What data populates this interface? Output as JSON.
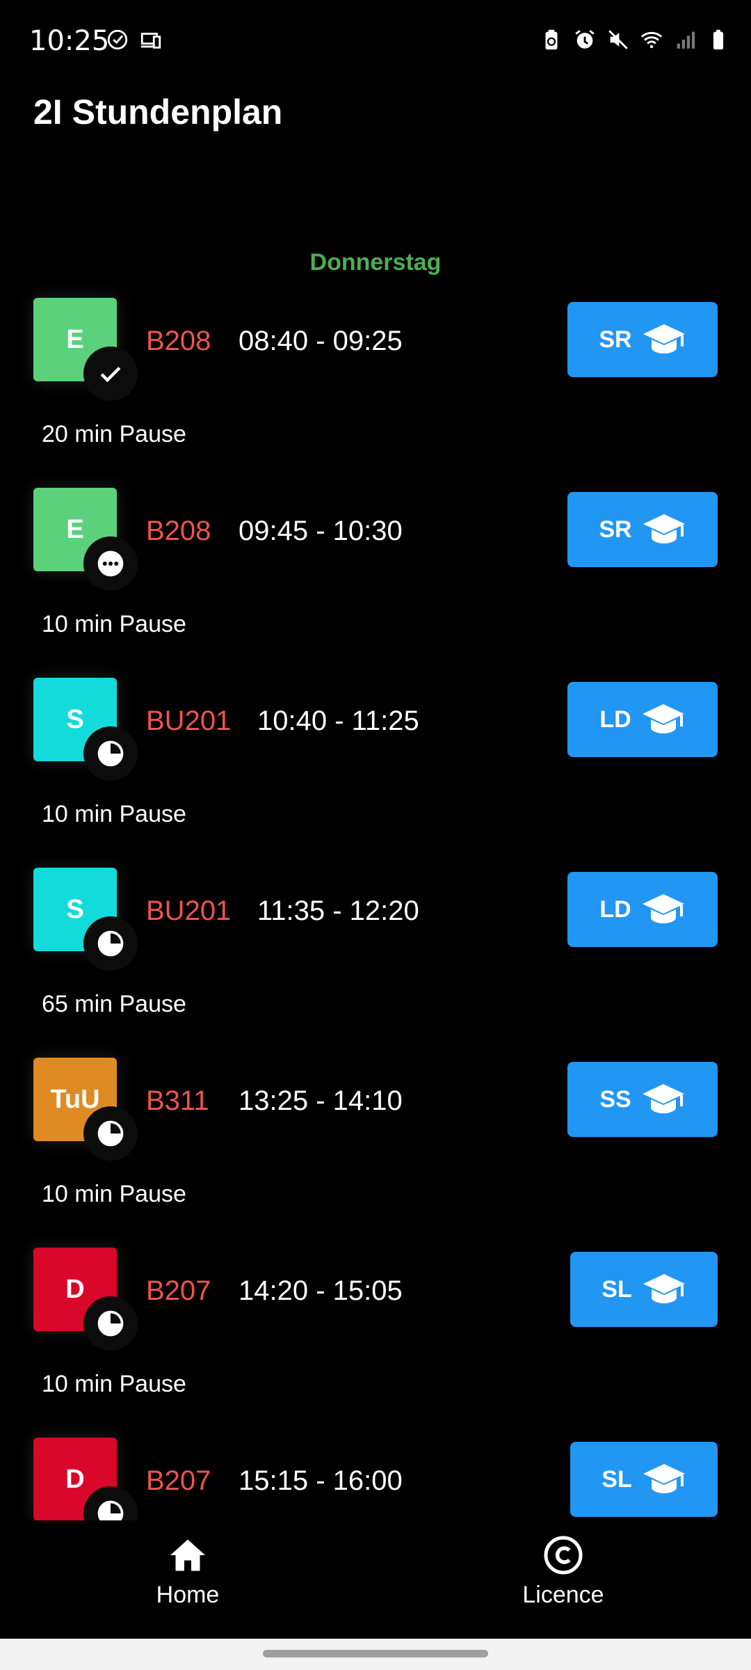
{
  "status_bar": {
    "time": "10:25",
    "left_icons": [
      "check-circle-icon",
      "devices-icon"
    ],
    "right_icons": [
      "battery-saver-icon",
      "alarm-icon",
      "mute-icon",
      "wifi-icon",
      "signal-icon",
      "battery-icon"
    ]
  },
  "app": {
    "title": "2I Stundenplan"
  },
  "day": "Donnerstag",
  "lessons": [
    {
      "subject": "E",
      "color": "#5bd17c",
      "status": "done",
      "room": "B208",
      "time": "08:40 - 09:25",
      "teacher": "SR"
    },
    {
      "subject": "E",
      "color": "#5bd17c",
      "status": "current",
      "room": "B208",
      "time": "09:45 - 10:30",
      "teacher": "SR"
    },
    {
      "subject": "S",
      "color": "#14dbdb",
      "status": "upcoming",
      "room": "BU201",
      "time": "10:40 - 11:25",
      "teacher": "LD"
    },
    {
      "subject": "S",
      "color": "#14dbdb",
      "status": "upcoming",
      "room": "BU201",
      "time": "11:35 - 12:20",
      "teacher": "LD"
    },
    {
      "subject": "TuU",
      "color": "#e08a24",
      "status": "upcoming",
      "room": "B311",
      "time": "13:25 - 14:10",
      "teacher": "SS"
    },
    {
      "subject": "D",
      "color": "#d9072a",
      "status": "upcoming",
      "room": "B207",
      "time": "14:20 - 15:05",
      "teacher": "SL"
    },
    {
      "subject": "D",
      "color": "#d9072a",
      "status": "upcoming",
      "room": "B207",
      "time": "15:15 - 16:00",
      "teacher": "SL"
    }
  ],
  "pauses": [
    "20 min Pause",
    "10 min Pause",
    "10 min Pause",
    "65 min Pause",
    "10 min Pause",
    "10 min Pause"
  ],
  "nav": {
    "home": {
      "label": "Home",
      "icon": "home-icon"
    },
    "licence": {
      "label": "Licence",
      "icon": "copyright-icon"
    }
  },
  "colors": {
    "background": "#000000",
    "accent": "#2196f3",
    "day": "#4caf50",
    "room": "#ef5350"
  }
}
